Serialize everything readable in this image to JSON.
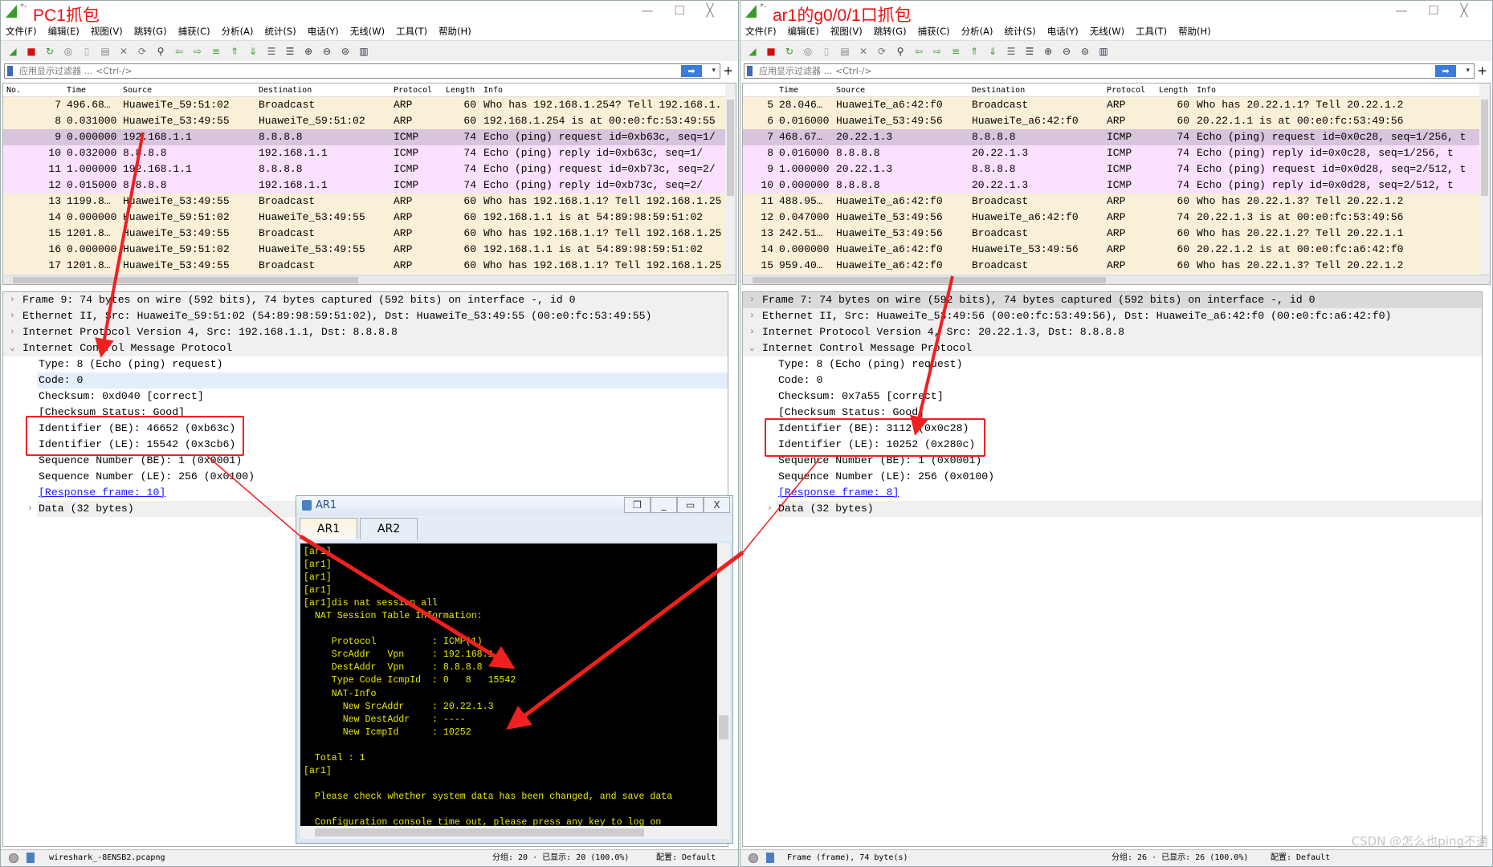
{
  "windows": [
    {
      "title": "PC1抓包",
      "modified_marker": "*-",
      "menu": [
        "文件(F)",
        "编辑(E)",
        "视图(V)",
        "跳转(G)",
        "捕获(C)",
        "分析(A)",
        "统计(S)",
        "电话(Y)",
        "无线(W)",
        "工具(T)",
        "帮助(H)"
      ],
      "filter_placeholder": "应用显示过滤器 … <Ctrl-/>",
      "columns": [
        "No.",
        "Time",
        "Source",
        "Destination",
        "Protocol",
        "Length",
        "Info"
      ],
      "packets": [
        {
          "no": "7",
          "time": "496.68…",
          "src": "HuaweiTe_59:51:02",
          "dst": "Broadcast",
          "proto": "ARP",
          "len": "60",
          "info": "Who has 192.168.1.254? Tell 192.168.1.",
          "type": "arp"
        },
        {
          "no": "8",
          "time": "0.031000",
          "src": "HuaweiTe_53:49:55",
          "dst": "HuaweiTe_59:51:02",
          "proto": "ARP",
          "len": "60",
          "info": "192.168.1.254 is at 00:e0:fc:53:49:55",
          "type": "arp"
        },
        {
          "no": "9",
          "time": "0.000000",
          "src": "192.168.1.1",
          "dst": "8.8.8.8",
          "proto": "ICMP",
          "len": "74",
          "info": "Echo (ping) request  id=0xb63c, seq=1/",
          "type": "sel"
        },
        {
          "no": "10",
          "time": "0.032000",
          "src": "8.8.8.8",
          "dst": "192.168.1.1",
          "proto": "ICMP",
          "len": "74",
          "info": "Echo (ping) reply    id=0xb63c, seq=1/",
          "type": "icmp"
        },
        {
          "no": "11",
          "time": "1.000000",
          "src": "192.168.1.1",
          "dst": "8.8.8.8",
          "proto": "ICMP",
          "len": "74",
          "info": "Echo (ping) request  id=0xb73c, seq=2/",
          "type": "icmp"
        },
        {
          "no": "12",
          "time": "0.015000",
          "src": "8.8.8.8",
          "dst": "192.168.1.1",
          "proto": "ICMP",
          "len": "74",
          "info": "Echo (ping) reply    id=0xb73c, seq=2/",
          "type": "icmp"
        },
        {
          "no": "13",
          "time": "1199.8…",
          "src": "HuaweiTe_53:49:55",
          "dst": "Broadcast",
          "proto": "ARP",
          "len": "60",
          "info": "Who has 192.168.1.1? Tell 192.168.1.25",
          "type": "arp"
        },
        {
          "no": "14",
          "time": "0.000000",
          "src": "HuaweiTe_59:51:02",
          "dst": "HuaweiTe_53:49:55",
          "proto": "ARP",
          "len": "60",
          "info": "192.168.1.1 is at 54:89:98:59:51:02",
          "type": "arp"
        },
        {
          "no": "15",
          "time": "1201.8…",
          "src": "HuaweiTe_53:49:55",
          "dst": "Broadcast",
          "proto": "ARP",
          "len": "60",
          "info": "Who has 192.168.1.1? Tell 192.168.1.25",
          "type": "arp"
        },
        {
          "no": "16",
          "time": "0.000000",
          "src": "HuaweiTe_59:51:02",
          "dst": "HuaweiTe_53:49:55",
          "proto": "ARP",
          "len": "60",
          "info": "192.168.1.1 is at 54:89:98:59:51:02",
          "type": "arp"
        },
        {
          "no": "17",
          "time": "1201.8…",
          "src": "HuaweiTe_53:49:55",
          "dst": "Broadcast",
          "proto": "ARP",
          "len": "60",
          "info": "Who has 192.168.1.1? Tell 192.168.1.25",
          "type": "arp"
        }
      ],
      "details": [
        {
          "text": "Frame 9: 74 bytes on wire (592 bits), 74 bytes captured (592 bits) on interface -, id 0",
          "level": 0,
          "exp": "›",
          "style": "top"
        },
        {
          "text": "Ethernet II, Src: HuaweiTe_59:51:02 (54:89:98:59:51:02), Dst: HuaweiTe_53:49:55 (00:e0:fc:53:49:55)",
          "level": 0,
          "exp": "›",
          "style": "top"
        },
        {
          "text": "Internet Protocol Version 4, Src: 192.168.1.1, Dst: 8.8.8.8",
          "level": 0,
          "exp": "›",
          "style": "top"
        },
        {
          "text": "Internet Control Message Protocol",
          "level": 0,
          "exp": "⌄",
          "style": "top"
        },
        {
          "text": "Type: 8 (Echo (ping) request)",
          "level": 1,
          "exp": "",
          "style": ""
        },
        {
          "text": "Code: 0",
          "level": 1,
          "exp": "",
          "style": "hl"
        },
        {
          "text": "Checksum: 0xd040 [correct]",
          "level": 1,
          "exp": "",
          "style": ""
        },
        {
          "text": "[Checksum Status: Good]",
          "level": 1,
          "exp": "",
          "style": ""
        },
        {
          "text": "Identifier (BE): 46652 (0xb63c)",
          "level": 1,
          "exp": "",
          "style": ""
        },
        {
          "text": "Identifier (LE): 15542 (0x3cb6)",
          "level": 1,
          "exp": "",
          "style": ""
        },
        {
          "text": "Sequence Number (BE): 1 (0x0001)",
          "level": 1,
          "exp": "",
          "style": ""
        },
        {
          "text": "Sequence Number (LE): 256 (0x0100)",
          "level": 1,
          "exp": "",
          "style": ""
        },
        {
          "text": "[Response frame: 10]",
          "level": 1,
          "exp": "",
          "style": "link"
        },
        {
          "text": "Data (32 bytes)",
          "level": 1,
          "exp": "›",
          "style": "top"
        }
      ],
      "status": {
        "file": "wireshark_-8ENSB2.pcapng",
        "packets": "分组: 20 · 已显示: 20 (100.0%)",
        "profile": "配置: Default"
      }
    },
    {
      "title": "ar1的g0/0/1口抓包",
      "modified_marker": "*-",
      "menu": [
        "文件(F)",
        "编辑(E)",
        "视图(V)",
        "跳转(G)",
        "捕获(C)",
        "分析(A)",
        "统计(S)",
        "电话(Y)",
        "无线(W)",
        "工具(T)",
        "帮助(H)"
      ],
      "filter_placeholder": "应用显示过滤器 … <Ctrl-/>",
      "columns": [
        "",
        "Time",
        "Source",
        "Destination",
        "Protocol",
        "Length",
        "Info"
      ],
      "packets": [
        {
          "no": "5",
          "time": "28.046…",
          "src": "HuaweiTe_a6:42:f0",
          "dst": "Broadcast",
          "proto": "ARP",
          "len": "60",
          "info": "Who has 20.22.1.1? Tell 20.22.1.2",
          "type": "arp"
        },
        {
          "no": "6",
          "time": "0.016000",
          "src": "HuaweiTe_53:49:56",
          "dst": "HuaweiTe_a6:42:f0",
          "proto": "ARP",
          "len": "60",
          "info": "20.22.1.1 is at 00:e0:fc:53:49:56",
          "type": "arp"
        },
        {
          "no": "7",
          "time": "468.67…",
          "src": "20.22.1.3",
          "dst": "8.8.8.8",
          "proto": "ICMP",
          "len": "74",
          "info": "Echo (ping) request  id=0x0c28, seq=1/256, t",
          "type": "sel"
        },
        {
          "no": "8",
          "time": "0.016000",
          "src": "8.8.8.8",
          "dst": "20.22.1.3",
          "proto": "ICMP",
          "len": "74",
          "info": "Echo (ping) reply    id=0x0c28, seq=1/256, t",
          "type": "icmp"
        },
        {
          "no": "9",
          "time": "1.000000",
          "src": "20.22.1.3",
          "dst": "8.8.8.8",
          "proto": "ICMP",
          "len": "74",
          "info": "Echo (ping) request  id=0x0d28, seq=2/512, t",
          "type": "icmp"
        },
        {
          "no": "10",
          "time": "0.000000",
          "src": "8.8.8.8",
          "dst": "20.22.1.3",
          "proto": "ICMP",
          "len": "74",
          "info": "Echo (ping) reply    id=0x0d28, seq=2/512, t",
          "type": "icmp"
        },
        {
          "no": "11",
          "time": "488.95…",
          "src": "HuaweiTe_a6:42:f0",
          "dst": "Broadcast",
          "proto": "ARP",
          "len": "60",
          "info": "Who has 20.22.1.3? Tell 20.22.1.2",
          "type": "arp"
        },
        {
          "no": "12",
          "time": "0.047000",
          "src": "HuaweiTe_53:49:56",
          "dst": "HuaweiTe_a6:42:f0",
          "proto": "ARP",
          "len": "74",
          "info": "20.22.1.3 is at 00:e0:fc:53:49:56",
          "type": "arp"
        },
        {
          "no": "13",
          "time": "242.51…",
          "src": "HuaweiTe_53:49:56",
          "dst": "Broadcast",
          "proto": "ARP",
          "len": "60",
          "info": "Who has 20.22.1.2? Tell 20.22.1.1",
          "type": "arp"
        },
        {
          "no": "14",
          "time": "0.000000",
          "src": "HuaweiTe_a6:42:f0",
          "dst": "HuaweiTe_53:49:56",
          "proto": "ARP",
          "len": "60",
          "info": "20.22.1.2 is at 00:e0:fc:a6:42:f0",
          "type": "arp"
        },
        {
          "no": "15",
          "time": "959.40…",
          "src": "HuaweiTe_a6:42:f0",
          "dst": "Broadcast",
          "proto": "ARP",
          "len": "60",
          "info": "Who has 20.22.1.3? Tell 20.22.1.2",
          "type": "arp"
        }
      ],
      "details": [
        {
          "text": "Frame 7: 74 bytes on wire (592 bits), 74 bytes captured (592 bits) on interface -, id 0",
          "level": 0,
          "exp": "›",
          "style": "selg"
        },
        {
          "text": "Ethernet II, Src: HuaweiTe_53:49:56 (00:e0:fc:53:49:56), Dst: HuaweiTe_a6:42:f0 (00:e0:fc:a6:42:f0)",
          "level": 0,
          "exp": "›",
          "style": "top"
        },
        {
          "text": "Internet Protocol Version 4, Src: 20.22.1.3, Dst: 8.8.8.8",
          "level": 0,
          "exp": "›",
          "style": "top"
        },
        {
          "text": "Internet Control Message Protocol",
          "level": 0,
          "exp": "⌄",
          "style": "top"
        },
        {
          "text": "Type: 8 (Echo (ping) request)",
          "level": 1,
          "exp": "",
          "style": ""
        },
        {
          "text": "Code: 0",
          "level": 1,
          "exp": "",
          "style": ""
        },
        {
          "text": "Checksum: 0x7a55 [correct]",
          "level": 1,
          "exp": "",
          "style": ""
        },
        {
          "text": "[Checksum Status: Good]",
          "level": 1,
          "exp": "",
          "style": ""
        },
        {
          "text": "Identifier (BE): 3112 (0x0c28)",
          "level": 1,
          "exp": "",
          "style": ""
        },
        {
          "text": "Identifier (LE): 10252 (0x280c)",
          "level": 1,
          "exp": "",
          "style": ""
        },
        {
          "text": "Sequence Number (BE): 1 (0x0001)",
          "level": 1,
          "exp": "",
          "style": ""
        },
        {
          "text": "Sequence Number (LE): 256 (0x0100)",
          "level": 1,
          "exp": "",
          "style": ""
        },
        {
          "text": "[Response frame: 8]",
          "level": 1,
          "exp": "",
          "style": "link"
        },
        {
          "text": "Data (32 bytes)",
          "level": 1,
          "exp": "›",
          "style": "top"
        }
      ],
      "status": {
        "file": "Frame (frame), 74 byte(s)",
        "packets": "分组: 26 · 已显示: 26 (100.0%)",
        "profile": "配置: Default"
      }
    }
  ],
  "console": {
    "title": "AR1",
    "tabs": [
      {
        "label": "AR1",
        "active": true
      },
      {
        "label": "AR2",
        "active": false
      }
    ],
    "lines": [
      "[ar1]",
      "[ar1]",
      "[ar1]",
      "[ar1]",
      "[ar1]dis nat session all",
      "  NAT Session Table Information:",
      "",
      "     Protocol          : ICMP(1)",
      "     SrcAddr   Vpn     : 192.168.1.1",
      "     DestAddr  Vpn     : 8.8.8.8",
      "     Type Code IcmpId  : 0   8   15542",
      "     NAT-Info",
      "       New SrcAddr     : 20.22.1.3",
      "       New DestAddr    : ----",
      "       New IcmpId      : 10252",
      "",
      "  Total : 1",
      "[ar1]",
      "",
      "  Please check whether system data has been changed, and save data",
      "",
      "  Configuration console time out, please press any key to log on"
    ]
  },
  "annotation_color": "#f02020",
  "row_colors": {
    "arp": "#faf0d7",
    "icmp": "#fce0ff",
    "selected": "#d8c4dc"
  },
  "watermark": "CSDN @怎么也ping不通"
}
